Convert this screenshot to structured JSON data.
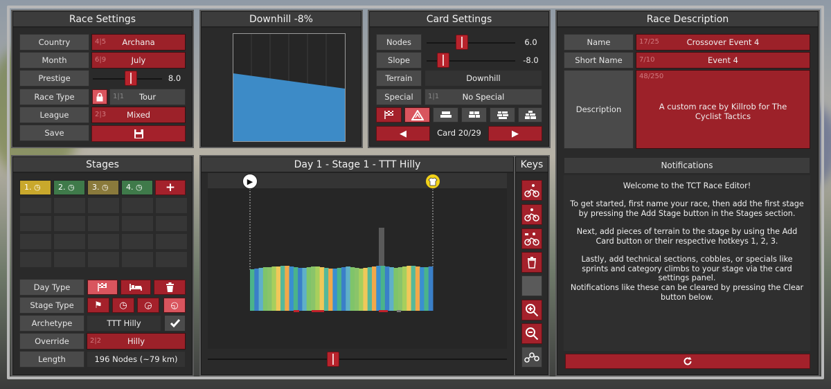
{
  "race_settings": {
    "title": "Race Settings",
    "country": {
      "label": "Country",
      "count": "4|5",
      "value": "Archana"
    },
    "month": {
      "label": "Month",
      "count": "6|9",
      "value": "July"
    },
    "prestige": {
      "label": "Prestige",
      "value": "8.0",
      "level": 0.55
    },
    "race_type": {
      "label": "Race Type",
      "count": "1|1",
      "value": "Tour",
      "lock_icon": "lock-icon"
    },
    "league": {
      "label": "League",
      "count": "2|3",
      "value": "Mixed"
    },
    "save": {
      "label": "Save",
      "icon": "floppy-disk-icon"
    }
  },
  "downhill": {
    "title": "Downhill -8%",
    "slope_percent": -8
  },
  "card_settings": {
    "title": "Card Settings",
    "nodes": {
      "label": "Nodes",
      "value": "6.0"
    },
    "slope": {
      "label": "Slope",
      "value": "-8.0"
    },
    "terrain": {
      "label": "Terrain",
      "value": "Downhill"
    },
    "special": {
      "label": "Special",
      "count": "1|1",
      "value": "No Special"
    },
    "type_icons": [
      "checkered-flag-icon",
      "road-sign-icon",
      "cobble-1-icon",
      "cobble-2-icon",
      "cobble-3-icon",
      "cobble-4-icon"
    ],
    "card_label": "Card 20/29"
  },
  "race_description": {
    "title": "Race Description",
    "name": {
      "label": "Name",
      "count": "17/25",
      "value": "Crossover Event 4"
    },
    "short_name": {
      "label": "Short Name",
      "count": "7/10",
      "value": "Event 4"
    },
    "description": {
      "label": "Description",
      "count": "48/250",
      "value": "A custom race by Killrob for The Cyclist Tactics"
    }
  },
  "stages": {
    "title": "Stages",
    "items": [
      {
        "label": "1.",
        "color": "#c9a82c"
      },
      {
        "label": "2.",
        "color": "#3f7a4a"
      },
      {
        "label": "3.",
        "color": "#8a7a3c"
      },
      {
        "label": "4.",
        "color": "#3f7a4a"
      }
    ],
    "day_type": {
      "label": "Day Type"
    },
    "stage_type": {
      "label": "Stage Type"
    },
    "archetype": {
      "label": "Archetype",
      "value": "TTT Hilly"
    },
    "override": {
      "label": "Override",
      "count": "2|2",
      "value": "Hilly"
    },
    "length": {
      "label": "Length",
      "value": "196 Nodes (~79 km)"
    }
  },
  "stage_view": {
    "title": "Day 1 - Stage 1 - TTT Hilly",
    "scroll_level": 0.42
  },
  "keys": {
    "title": "Keys",
    "icons": [
      "cyclist-sprint-icon",
      "cyclist-climb-icon",
      "cyclist-cobbles-icon",
      "trash-icon",
      "blank-key",
      "zoom-in-icon",
      "zoom-out-icon",
      "route-icon"
    ]
  },
  "notifications": {
    "title": "Notifications",
    "lines": [
      "Welcome to the TCT Race Editor!",
      "To get started, first name your race, then add the first stage by pressing the Add Stage button in the Stages section.",
      "Next, add pieces of terrain to the stage by using the Add Card button or their respective hotkeys 1, 2, 3.",
      "Lastly, add technical sections, cobbles, or specials like sprints and category climbs to your stage via the card settings panel.",
      "Notifications like these can be cleared by pressing the Clear button below."
    ],
    "clear_icon": "refresh-icon"
  }
}
